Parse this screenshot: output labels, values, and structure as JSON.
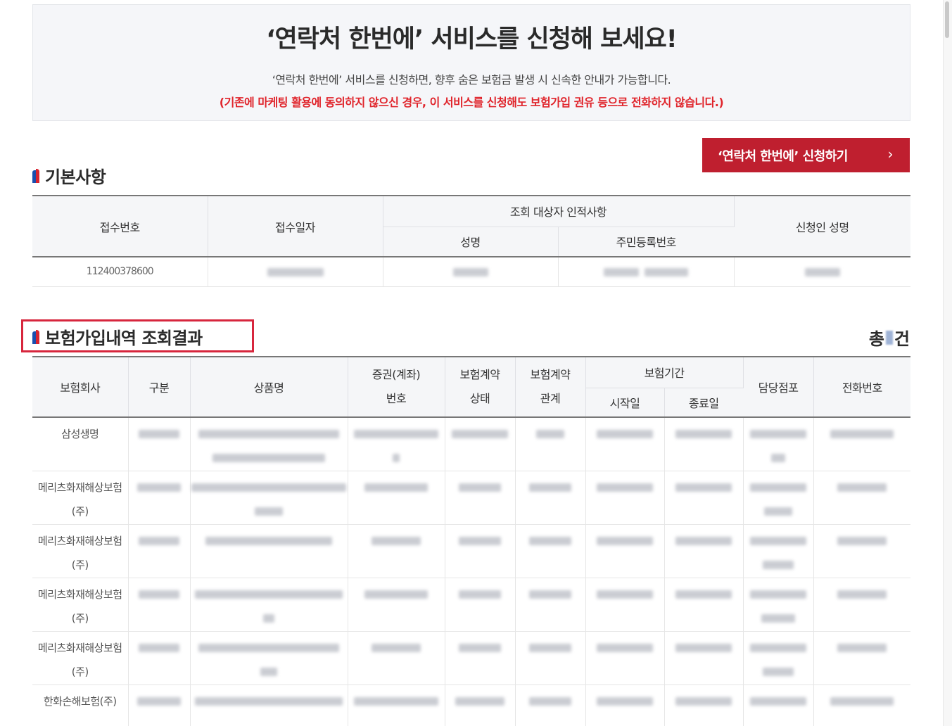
{
  "banner": {
    "title": "‘연락처 한번에’ 서비스를 신청해 보세요!",
    "desc": "‘연락처 한번에’ 서비스를 신청하면, 향후 숨은 보험금 발생 시 신속한 안내가 가능합니다.",
    "warning": "(기존에 마케팅 활용에 동의하지 않으신 경우, 이 서비스를 신청해도 보험가입 권유 등으로 전화하지 않습니다.)"
  },
  "apply_button": {
    "label": "‘연락처 한번에’ 신청하기",
    "chevron": "›"
  },
  "basic": {
    "title": "기본사항",
    "headers": {
      "receipt_no": "접수번호",
      "receipt_date": "접수일자",
      "target_group": "조회 대상자 인적사항",
      "name": "성명",
      "rrn": "주민등록번호",
      "applicant": "신청인 성명"
    },
    "row": {
      "receipt_no": "112400378600"
    }
  },
  "results": {
    "title": "보험가입내역 조회결과",
    "total_prefix": "총",
    "total_suffix": "건",
    "headers": {
      "company": "보험회사",
      "category": "구분",
      "product": "상품명",
      "policy_no_1": "증권(계좌)",
      "policy_no_2": "번호",
      "status_1": "보험계약",
      "status_2": "상태",
      "relation_1": "보험계약",
      "relation_2": "관계",
      "period": "보험기간",
      "start": "시작일",
      "end": "종료일",
      "branch": "담당점포",
      "phone": "전화번호"
    },
    "rows": [
      {
        "company": "삼성생명"
      },
      {
        "company": "메리츠화재해상보험(주)"
      },
      {
        "company": "메리츠화재해상보험(주)"
      },
      {
        "company": "메리츠화재해상보험(주)"
      },
      {
        "company": "메리츠화재해상보험(주)"
      },
      {
        "company": "한화손해보험(주)"
      }
    ]
  },
  "icons": {
    "section_flag": "section-flag-icon",
    "chevron": "chevron-right-icon"
  },
  "colors": {
    "accent_red": "#bf1f2f",
    "warning_red": "#e0242b",
    "flag_blue": "#1a4fae",
    "highlight": "#d7263d"
  }
}
